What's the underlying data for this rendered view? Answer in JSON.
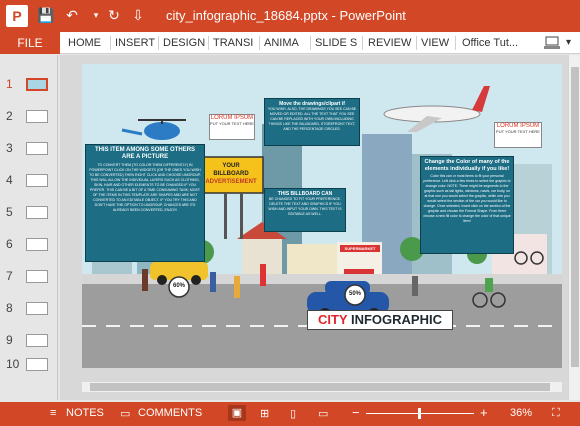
{
  "titlebar": {
    "app_letter": "P",
    "doc_title": "city_infographic_18684.pptx - PowerPoint",
    "save_glyph": "💾",
    "undo_glyph": "↶",
    "redo_glyph": "↻",
    "customize_glyph": "⇩"
  },
  "ribbon": {
    "file_label": "FILE",
    "tabs": [
      "HOME",
      "INSERT",
      "DESIGN",
      "TRANSI",
      "ANIMA",
      "SLIDE S",
      "REVIEW",
      "VIEW",
      "Office Tut..."
    ]
  },
  "thumbnails": [
    "1",
    "2",
    "3",
    "4",
    "5",
    "6",
    "7",
    "8",
    "9",
    "10"
  ],
  "slide": {
    "title_red": "CITY",
    "title_dark": " INFOGRAPHIC",
    "callout_left_title": "THIS ITEM AMONG SOME OTHERS ARE A PICTURE",
    "callout_left_body": "TO CONVERT THEM (TO COLOR THEM DIFFERENTLY) IN POWERPOINT CLICK ON THE WIDGETS (OR THE ONES YOU WISH TO BE CONVERTED) THEN RIGHT CLICK AND CHOOSE UNGROUP. THIS WILL ALLOW THE INDIVIDUAL LAYERS SUCH AS CLOTHING, SKIN, HAIR AND OTHER ELEMENTS TO BE CHANGED IF YOU PREFER. THIS CAN BE A BIT OF A TIME CONSUMING TASK; MOST OF THE ITEMS IN THIS TEMPLATE ARE SHAPES AND ARE NOT CONVERTED TO AN EDITABLE OBJECT. IF YOU TRY THIS AND DON'T HAVE THE OPTION TO UNGROUP, CHANCES ARE ITS ALREADY BEEN CONVERTED, ENJOY!",
    "callout_top_title": "Move the drawings/clipart if",
    "callout_top_body": "YOU WISH. ALSO, THE DRAWINGS YOU SEE CAN BE MOVED OR EDITED. ALL THE TEXT THAT YOU SEE CAN BE REPLACED WITH YOUR OWN INCLUDING THINGS LIKE THE BILLBOARD, STOREFRONT TEXT, AND THE PERCENTAGE CIRCLES.",
    "callout_right_title": "Change the Color of many of the elements individually if you like!",
    "callout_right_body": "Color this can or most items to fit your personal preference. Left click a few times to select the graphic to change color. NOTE: There might be segments to the graphic such as tail lights, windows, roads, car body, so at that one you would select the graphic, while one you would select the section of the car you would like to change. Once selected, Insert click on the section of the graphic and choose the Format Shape. From there choose a new fill color to change the color of that unique item!",
    "billboard_callout_title": "THIS BILLBOARD CAN",
    "billboard_callout_body": "BE CHANGED TO FIT YOUR PREFERENCE. DELETE THE TEXT AND GRAPHICS IF YOU WISH AND INPUT YOUR OWN. THIS TEXT IS EDITABLE AS WELL.",
    "billboard_line1": "YOUR",
    "billboard_line2": "BILLBOARD",
    "billboard_line3": "ADVERTISEMENT",
    "lorum_heading": "LORUM IPSUM",
    "lorum_sub": "PUT YOUR TEXT HERE",
    "supermarket": "SUPERMARKET",
    "pct_left": "60%",
    "pct_mid": "50%"
  },
  "statusbar": {
    "notes": "NOTES",
    "comments": "COMMENTS",
    "zoom": "36%",
    "minus": "−",
    "plus": "+"
  },
  "colors": {
    "accent": "#d24726",
    "sky": "#cfe7ef",
    "callout": "#1d6d84",
    "title_red": "#e0262b"
  }
}
